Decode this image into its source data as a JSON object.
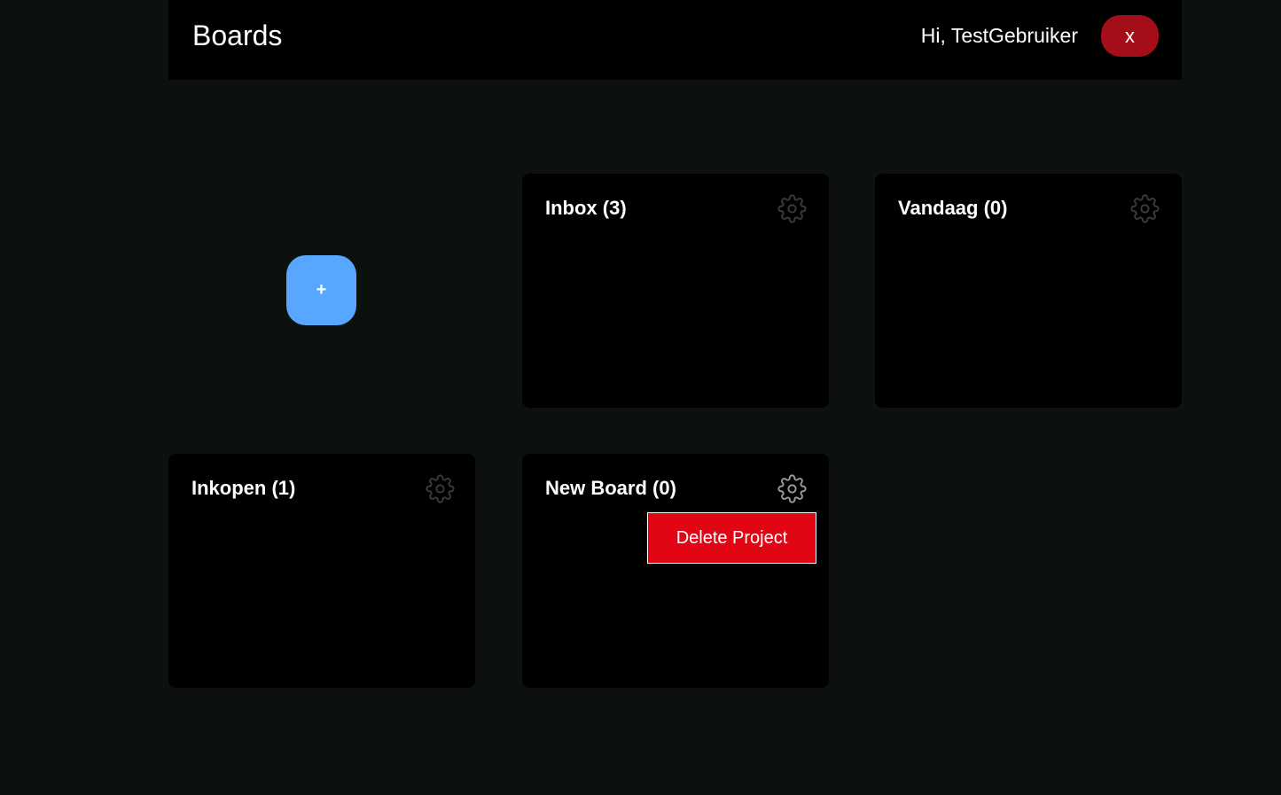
{
  "header": {
    "title": "Boards",
    "greeting": "Hi, TestGebruiker",
    "logout_label": "x"
  },
  "add_button": {
    "label": "+"
  },
  "boards": [
    {
      "title": "Inbox (3)"
    },
    {
      "title": "Vandaag (0)"
    },
    {
      "title": "Inkopen (1)"
    },
    {
      "title": "New Board (0)",
      "menu": {
        "delete_label": "Delete Project"
      }
    }
  ],
  "colors": {
    "background": "#0d110e",
    "card": "#000000",
    "logout": "#a40e19",
    "add": "#58a6ff",
    "delete": "#e20614"
  },
  "icons": {
    "settings": "gear-icon"
  }
}
